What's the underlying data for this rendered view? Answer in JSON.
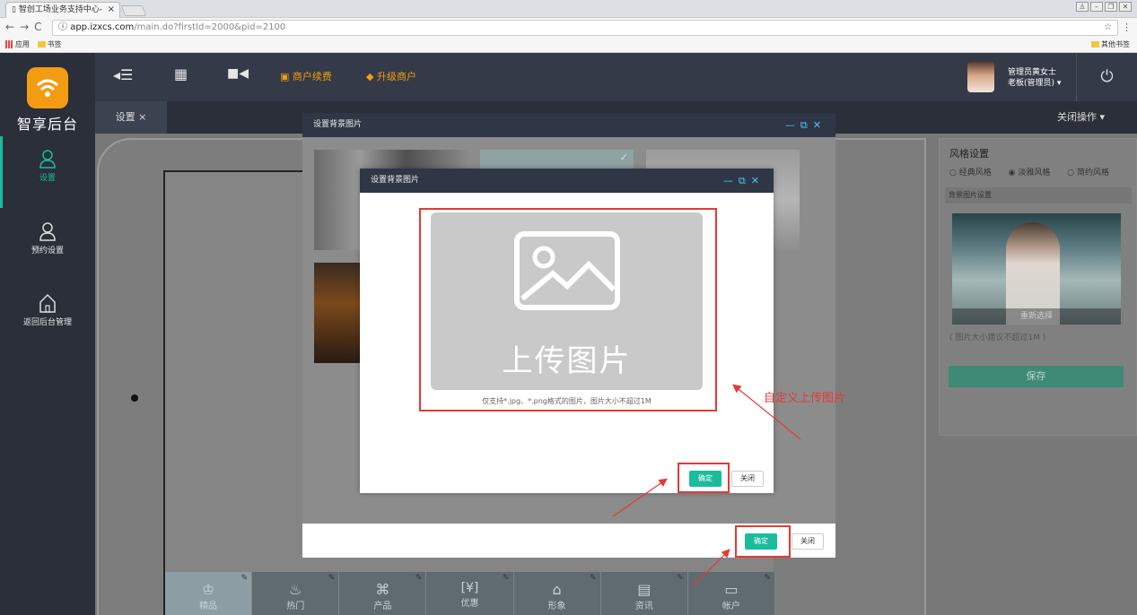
{
  "browser": {
    "tab_title": "智创工场业务支持中心-",
    "tab_close": "×",
    "url_host": "app.izxcs.com",
    "url_path": "/main.do?firstId=2000&pid=2100",
    "bookmarks_apps": "应用",
    "bookmarks_folder": "书签",
    "bookmarks_other": "其他书签"
  },
  "sidebar": {
    "brand": "智享后台",
    "items": [
      {
        "label": "设置",
        "icon": "user-icon"
      },
      {
        "label": "预约设置",
        "icon": "user-icon"
      },
      {
        "label": "返回后台管理",
        "icon": "home-icon"
      }
    ]
  },
  "topbar": {
    "renew_label": "商户续费",
    "upgrade_label": "升级商户",
    "user_name": "管理员黄女士",
    "user_role": "老板(管理员) ▾"
  },
  "subbar": {
    "tab_label": "设置 ×",
    "close_ops": "关闭操作 ▾"
  },
  "right_panel": {
    "title": "风格设置",
    "styles": [
      "经典风格",
      "淡雅风格",
      "简约风格"
    ],
    "selected_style": "淡雅风格",
    "bg_section": "背景图片设置",
    "reselect": "重新选择",
    "hint": "( 图片大小建议不超过1M )",
    "save_label": "保存"
  },
  "bottom_nav": [
    "精品",
    "热门",
    "产品",
    "优惠",
    "形象",
    "资讯",
    "帐户"
  ],
  "outer_modal": {
    "title": "设置背景图片",
    "ok_label": "确定",
    "close_label": "关闭"
  },
  "inner_modal": {
    "title": "设置背景图片",
    "upload_text": "上传图片",
    "upload_hint": "仅支持*.jpg、*.png格式的图片，图片大小不超过1M",
    "ok_label": "确定",
    "close_label": "关闭"
  },
  "annotation": "自定义上传图片",
  "colors": {
    "accent": "#1abc9c",
    "brand_orange": "#f39c12",
    "annotation_red": "#e53935",
    "dark_nav": "#2a2f3a"
  }
}
